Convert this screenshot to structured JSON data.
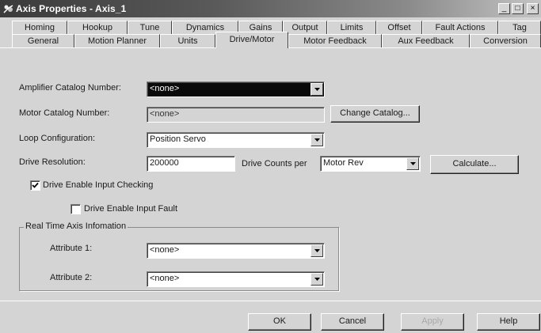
{
  "window": {
    "title": "Axis Properties - Axis_1",
    "minimize_glyph": "_",
    "maximize_glyph": "□",
    "close_glyph": "×"
  },
  "tabs": {
    "back_row": [
      "Homing",
      "Hookup",
      "Tune",
      "Dynamics",
      "Gains",
      "Output",
      "Limits",
      "Offset",
      "Fault Actions",
      "Tag"
    ],
    "front_row": [
      "General",
      "Motion Planner",
      "Units",
      "Drive/Motor",
      "Motor Feedback",
      "Aux Feedback",
      "Conversion"
    ],
    "active": "Drive/Motor"
  },
  "form": {
    "amplifier_catalog": {
      "label": "Amplifier Catalog Number:",
      "value": "<none>"
    },
    "motor_catalog": {
      "label": "Motor Catalog Number:",
      "value": "<none>"
    },
    "change_catalog_button": "Change Catalog...",
    "loop_configuration": {
      "label": "Loop Configuration:",
      "value": "Position Servo"
    },
    "drive_resolution": {
      "label": "Drive Resolution:",
      "value": "200000"
    },
    "drive_counts_per": {
      "label": "Drive Counts per",
      "value": "Motor Rev"
    },
    "calculate_button": "Calculate...",
    "drive_enable_input_checking": {
      "label": "Drive Enable Input Checking",
      "checked": true
    },
    "drive_enable_input_fault": {
      "label": "Drive Enable Input Fault",
      "checked": false
    }
  },
  "realtime_group": {
    "title": "Real Time Axis Infomation",
    "attribute1": {
      "label": "Attribute 1:",
      "value": "<none>"
    },
    "attribute2": {
      "label": "Attribute 2:",
      "value": "<none>"
    }
  },
  "footer": {
    "ok": "OK",
    "cancel": "Cancel",
    "apply": "Apply",
    "help": "Help"
  },
  "icons": {
    "app": "axis-properties-icon",
    "dropdown": "chevron-down-icon",
    "check": "checkmark-icon"
  }
}
